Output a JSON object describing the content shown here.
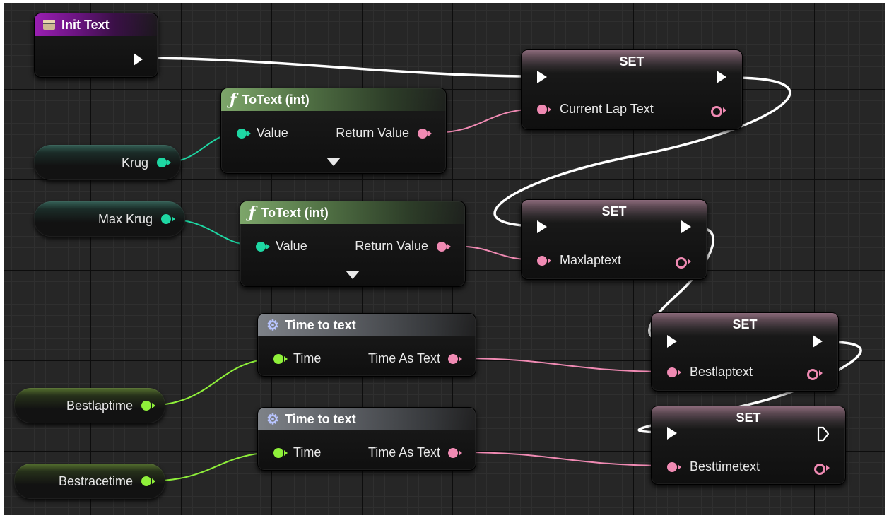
{
  "init_text": {
    "title": "Init Text"
  },
  "totext_1": {
    "title": "ToText (int)",
    "input": "Value",
    "output": "Return Value"
  },
  "totext_2": {
    "title": "ToText (int)",
    "input": "Value",
    "output": "Return Value"
  },
  "time_to_text_1": {
    "title": "Time to text",
    "input": "Time",
    "output": "Time As Text"
  },
  "time_to_text_2": {
    "title": "Time to text",
    "input": "Time",
    "output": "Time As Text"
  },
  "set_1": {
    "title": "SET",
    "variable": "Current Lap Text"
  },
  "set_2": {
    "title": "SET",
    "variable": "Maxlaptext"
  },
  "set_3": {
    "title": "SET",
    "variable": "Bestlaptext"
  },
  "set_4": {
    "title": "SET",
    "variable": "Besttimetext"
  },
  "variables": {
    "krug": "Krug",
    "max_krug": "Max Krug",
    "bestlaptime": "Bestlaptime",
    "bestracetime": "Bestracetime"
  },
  "function_icon": "ƒ",
  "icons": {
    "event": "event-icon",
    "function": "function-icon",
    "time_macro": "gear-icon"
  },
  "colors": {
    "event_header": "#9a1fb3",
    "function_header": "#7da66a",
    "macro_header": "#7e8288",
    "text_pin": "#f08ab3",
    "int_pin": "#1ed7a3",
    "float_pin": "#8ff03a",
    "exec_wire": "#ffffff"
  }
}
